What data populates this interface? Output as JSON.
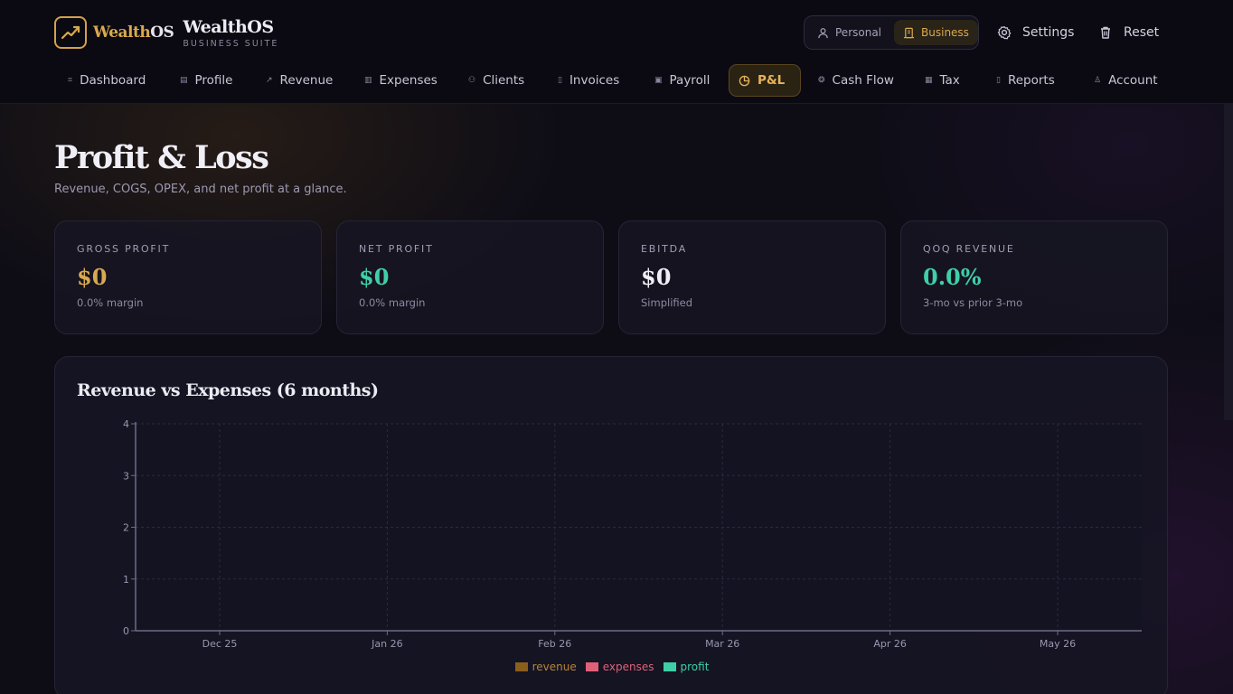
{
  "brand": {
    "logo_word_a": "Wealth",
    "logo_word_b": "OS",
    "name": "WealthOS",
    "subtitle": "BUSINESS SUITE"
  },
  "mode_toggle": {
    "personal": "Personal",
    "business": "Business",
    "active": "Business"
  },
  "header_actions": {
    "settings": "Settings",
    "reset": "Reset"
  },
  "nav": {
    "items": [
      {
        "label": "Dashboard",
        "icon": "dashboard-icon"
      },
      {
        "label": "Profile",
        "icon": "building-icon"
      },
      {
        "label": "Revenue",
        "icon": "trend-icon"
      },
      {
        "label": "Expenses",
        "icon": "receipt-icon"
      },
      {
        "label": "Clients",
        "icon": "users-icon"
      },
      {
        "label": "Invoices",
        "icon": "document-icon"
      },
      {
        "label": "Payroll",
        "icon": "wallet-icon"
      },
      {
        "label": "P&L",
        "icon": "pie-icon"
      },
      {
        "label": "Cash Flow",
        "icon": "flow-icon"
      },
      {
        "label": "Tax",
        "icon": "calculator-icon"
      },
      {
        "label": "Reports",
        "icon": "report-icon"
      },
      {
        "label": "Account",
        "icon": "user-icon"
      }
    ],
    "active": "P&L"
  },
  "page": {
    "title": "Profit & Loss",
    "subtitle": "Revenue, COGS, OPEX, and net profit at a glance."
  },
  "cards": [
    {
      "label": "GROSS PROFIT",
      "value": "$0",
      "note": "0.0% margin"
    },
    {
      "label": "NET PROFIT",
      "value": "$0",
      "note": "0.0% margin"
    },
    {
      "label": "EBITDA",
      "value": "$0",
      "note": "Simplified"
    },
    {
      "label": "QOQ REVENUE",
      "value": "0.0%",
      "note": "3-mo vs prior 3-mo"
    }
  ],
  "colors": {
    "accent_gold": "#d9a94e",
    "accent_teal": "#3fcfa6",
    "revenue": "#8a5e1c",
    "expenses": "#e0607a",
    "profit": "#3fcfa6"
  },
  "chart_data": {
    "type": "bar",
    "title": "Revenue vs Expenses (6 months)",
    "categories": [
      "Dec 25",
      "Jan 26",
      "Feb 26",
      "Mar 26",
      "Apr 26",
      "May 26"
    ],
    "series": [
      {
        "name": "revenue",
        "values": [
          0,
          0,
          0,
          0,
          0,
          0
        ]
      },
      {
        "name": "expenses",
        "values": [
          0,
          0,
          0,
          0,
          0,
          0
        ]
      },
      {
        "name": "profit",
        "values": [
          0,
          0,
          0,
          0,
          0,
          0
        ]
      }
    ],
    "yticks": [
      0,
      1,
      2,
      3,
      4
    ],
    "ylim": [
      0,
      4
    ],
    "xlabel": "",
    "ylabel": "",
    "grid": true,
    "legend": "bottom-center"
  }
}
